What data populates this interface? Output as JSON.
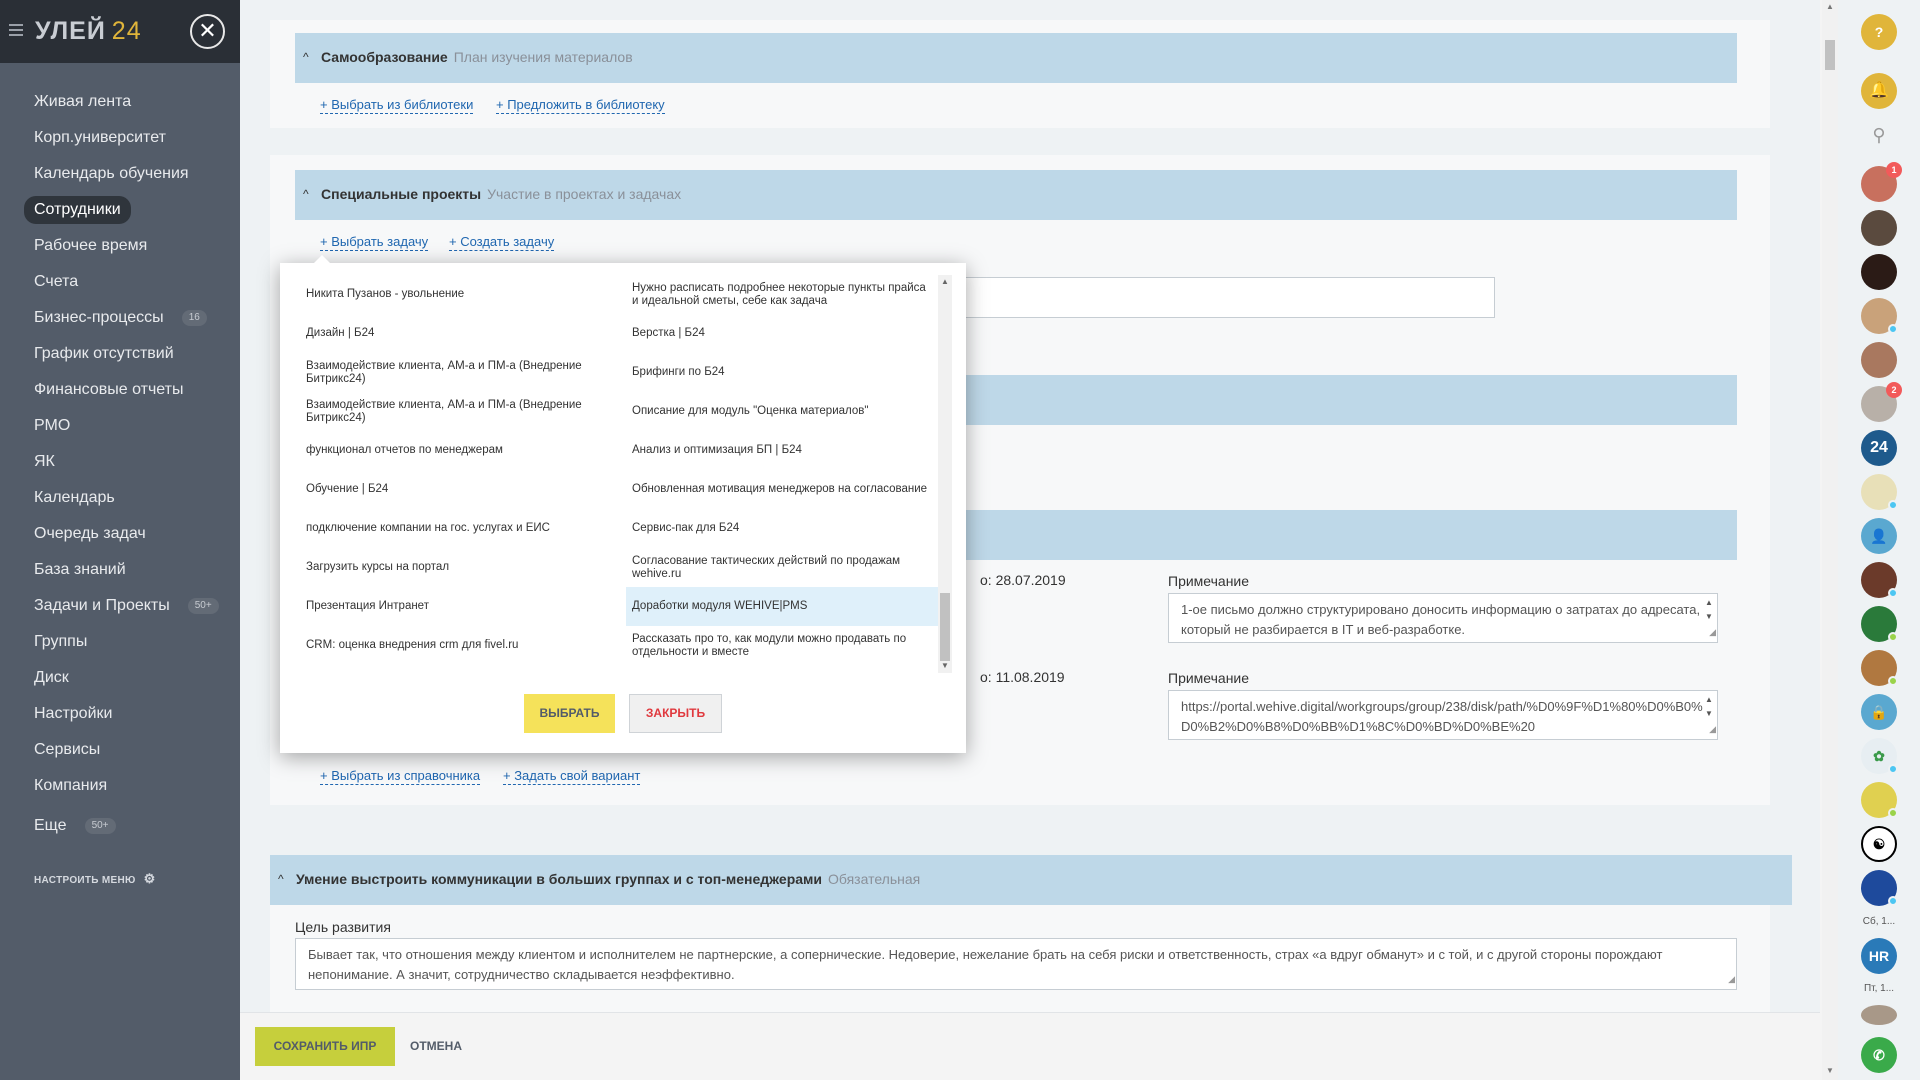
{
  "sidebar": {
    "logo_text": "УЛЕЙ",
    "logo_num": "24",
    "items": [
      {
        "label": "Живая лента"
      },
      {
        "label": "Корп.университет"
      },
      {
        "label": "Календарь обучения"
      },
      {
        "label": "Сотрудники",
        "active": true
      },
      {
        "label": "Рабочее время"
      },
      {
        "label": "Счета"
      },
      {
        "label": "Бизнес-процессы",
        "badge": "16"
      },
      {
        "label": "График отсутствий"
      },
      {
        "label": "Финансовые отчеты"
      },
      {
        "label": "РМО"
      },
      {
        "label": "ЯК"
      },
      {
        "label": "Календарь"
      },
      {
        "label": "Очередь задач"
      },
      {
        "label": "База знаний"
      },
      {
        "label": "Задачи и Проекты",
        "badge": "50+"
      },
      {
        "label": "Группы"
      },
      {
        "label": "Диск"
      },
      {
        "label": "Настройки"
      },
      {
        "label": "Сервисы"
      },
      {
        "label": "Компания"
      },
      {
        "label": "Еще",
        "badge": "50+"
      }
    ],
    "configure_label": "НАСТРОИТЬ МЕНЮ"
  },
  "main": {
    "self_education": {
      "title": "Самообразование",
      "subtitle": "План изучения материалов",
      "link1": "+ Выбрать из библиотеки",
      "link2": "+ Предложить в библиотеку"
    },
    "special_projects": {
      "title": "Специальные проекты",
      "subtitle": "Участие в проектах и задачах",
      "link1": "+ Выбрать задачу",
      "link2": "+ Создать задачу"
    },
    "row1": {
      "date": "о: 28.07.2019",
      "note_label": "Примечание",
      "note_text": "1-ое письмо должно структурировано доносить информацию о затратах до адресата, который не разбирается в IT  и веб-разработке."
    },
    "row2": {
      "date": "о: 11.08.2019",
      "note_label": "Примечание",
      "note_text": "https://portal.wehive.digital/workgroups/group/238/disk/path/%D0%9F%D1%80%D0%B0%D0%B2%D0%B8%D0%BB%D1%8C%D0%BD%D0%BE%20"
    },
    "ref_links": {
      "link1": "+ Выбрать из справочника",
      "link2": "+ Задать свой вариант"
    },
    "communication": {
      "title": "Умение выстроить коммуникации в больших группах и с топ-менеджерами",
      "subtitle": "Обязательная",
      "goal_label": "Цель развития",
      "goal_text": "Бывает так, что отношения между клиентом и исполнителем не партнерские, а сопернические. Недоверие, нежелание брать на себя риски и ответственность, страх «а вдруг обманут» и с той, и с другой стороны порождают непонимание. А значит, сотрудничество складывается неэффективно."
    }
  },
  "bottom_bar": {
    "save_label": "СОХРАНИТЬ ИПР",
    "cancel_label": "ОТМЕНА"
  },
  "modal": {
    "rows": [
      {
        "left": "Никита Пузанов - увольнение",
        "right": "Нужно расписать подробнее некоторые пункты прайса и идеальной сметы, себе как задача"
      },
      {
        "left": "Дизайн | Б24",
        "right": "Верстка | Б24"
      },
      {
        "left": "Взаимодействие клиента, АМ-а и ПМ-а (Внедрение Битрикс24)",
        "right": "Брифинги по Б24"
      },
      {
        "left": "Взаимодействие клиента, АМ-а и ПМ-а (Внедрение Битрикс24)",
        "right": "Описание для модуль \"Оценка материалов\""
      },
      {
        "left": "функционал отчетов по менеджерам",
        "right": "Анализ и оптимизация БП | Б24"
      },
      {
        "left": "Обучение | Б24",
        "right": "Обновленная мотивация менеджеров на согласование"
      },
      {
        "left": "подключение компании на гос. услугах и ЕИС",
        "right": "Сервис-пак для Б24"
      },
      {
        "left": "Загрузить курсы на портал",
        "right": "Согласование тактических действий по продажам wehive.ru"
      },
      {
        "left": "Презентация Интранет",
        "right": "Доработки модуля WEHIVE|PMS",
        "right_selected": true
      },
      {
        "left": "CRM: оценка внедрения crm для fivel.ru",
        "right": "Рассказать про то, как модули можно продавать по отдельности и вместе"
      }
    ],
    "select_label": "ВЫБРАТЬ",
    "close_label": "ЗАКРЫТЬ"
  },
  "right_panel": {
    "help": "?",
    "avatar_24": "24",
    "avatar_hr": "HR",
    "label_sat": "Сб, 1...",
    "label_fri": "Пт, 1...",
    "badge_1": "1",
    "badge_2": "2"
  }
}
